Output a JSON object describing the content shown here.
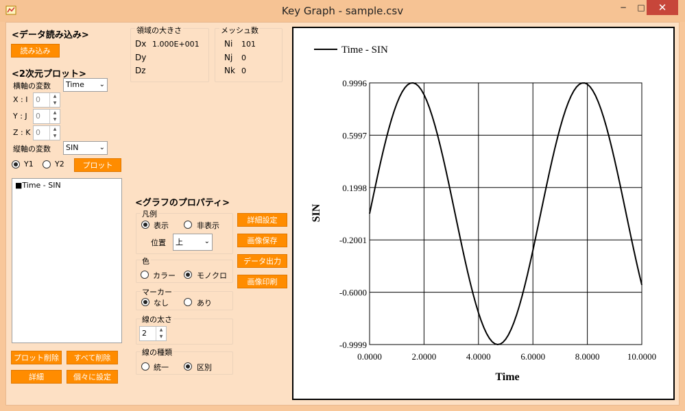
{
  "window": {
    "title": "Key Graph - sample.csv",
    "minimize": "─",
    "maximize": "□",
    "close": "✕"
  },
  "load": {
    "heading": "<データ読み込み>",
    "button": "読み込み"
  },
  "plot2d": {
    "heading": "<2次元プロット>",
    "xvar_label": "横軸の変数",
    "xvar_value": "Time",
    "x_label": "X : I",
    "x_value": "0",
    "y_label": "Y : J",
    "y_value": "0",
    "z_label": "Z : K",
    "z_value": "0",
    "yvar_label": "縦軸の変数",
    "yvar_value": "SIN",
    "y1": "Y1",
    "y2": "Y2",
    "plot_button": "プロット",
    "list_items": [
      "■Time - SIN"
    ],
    "delete_button": "プロット削除",
    "delete_all_button": "すべて削除",
    "detail_button": "詳細",
    "individual_button": "個々に設定"
  },
  "region": {
    "heading": "領域の大きさ",
    "dx_label": "Dx",
    "dx_value": "1.000E+001",
    "dy_label": "Dy",
    "dz_label": "Dz"
  },
  "mesh": {
    "heading": "メッシュ数",
    "ni_label": "Ni",
    "ni_value": "101",
    "nj_label": "Nj",
    "nj_value": "0",
    "nk_label": "Nk",
    "nk_value": "0"
  },
  "props": {
    "heading": "<グラフのプロパティ>",
    "legend_label": "凡例",
    "show": "表示",
    "hide": "非表示",
    "position_label": "位置",
    "position_value": "上",
    "color_label": "色",
    "color_opt": "カラー",
    "mono_opt": "モノクロ",
    "marker_label": "マーカー",
    "none_opt": "なし",
    "some_opt": "あり",
    "width_label": "線の太さ",
    "width_value": "2",
    "linetype_label": "線の種類",
    "unify_opt": "統一",
    "distinct_opt": "区別",
    "btn_detail": "詳細設定",
    "btn_save": "画像保存",
    "btn_export": "データ出力",
    "btn_print": "画像印刷"
  },
  "chart_data": {
    "type": "line",
    "xlabel": "Time",
    "ylabel": "SIN",
    "x_ticks": [
      "0.0000",
      "2.0000",
      "4.0000",
      "6.0000",
      "8.0000",
      "10.0000"
    ],
    "y_ticks": [
      "0.9996",
      "0.5997",
      "0.1998",
      "-0.2001",
      "-0.6000",
      "-0.9999"
    ],
    "xlim": [
      0,
      10
    ],
    "ylim": [
      -0.9999,
      0.9996
    ],
    "grid": true,
    "legend_position": "top-left",
    "series": [
      {
        "name": "Time - SIN",
        "function": "sin(x)",
        "x_start": 0,
        "x_end": 10,
        "points": 101,
        "color": "#000000"
      }
    ]
  }
}
